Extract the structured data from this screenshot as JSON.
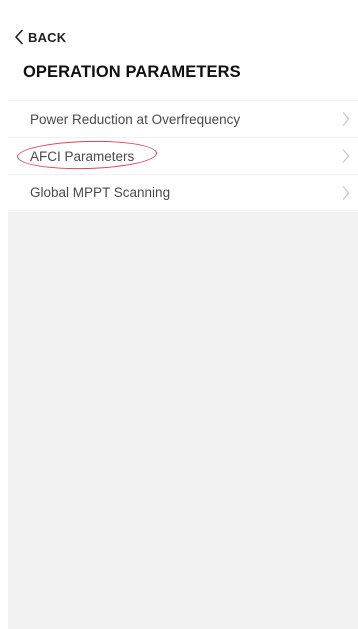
{
  "nav": {
    "back_label": "BACK",
    "back_icon": "chevron-left-icon"
  },
  "header": {
    "title": "OPERATION PARAMETERS"
  },
  "list": {
    "items": [
      {
        "label": "Power Reduction at Overfrequency",
        "icon": "chevron-right-icon"
      },
      {
        "label": "AFCI Parameters",
        "icon": "chevron-right-icon",
        "highlighted": true
      },
      {
        "label": "Global MPPT Scanning",
        "icon": "chevron-right-icon"
      }
    ]
  },
  "colors": {
    "highlight_ring": "#d9455b",
    "empty_area": "#f2f2f2",
    "chevron": "#c7c7c7"
  }
}
